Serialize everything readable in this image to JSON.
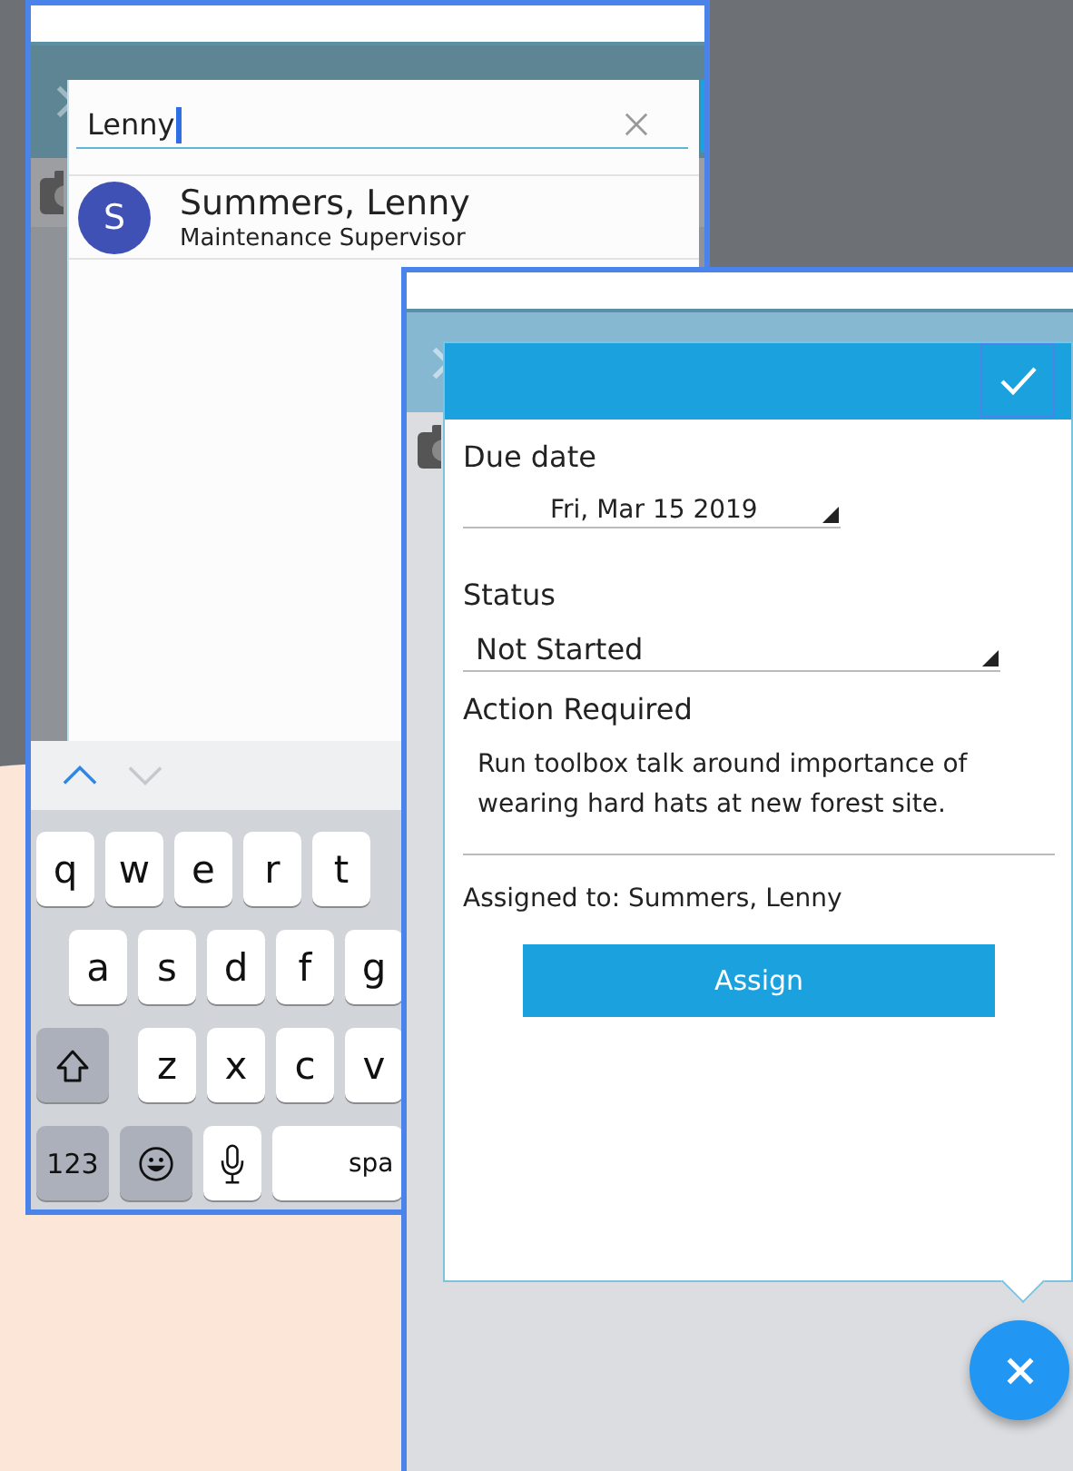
{
  "search_screen": {
    "search": {
      "value": "Lenny"
    },
    "results": [
      {
        "initial": "S",
        "name": "Summers, Lenny",
        "subtitle": "Maintenance Supervisor"
      }
    ],
    "keyboard": {
      "nav": [
        {
          "kind": "up",
          "disabled": false
        },
        {
          "kind": "down",
          "disabled": true
        }
      ],
      "rows": [
        {
          "keys": [
            {
              "kind": "letter",
              "label": "q"
            },
            {
              "kind": "letter",
              "label": "w"
            },
            {
              "kind": "letter",
              "label": "e"
            },
            {
              "kind": "letter",
              "label": "r"
            },
            {
              "kind": "letter",
              "label": "t"
            }
          ]
        },
        {
          "keys": [
            {
              "kind": "letter",
              "label": "a"
            },
            {
              "kind": "letter",
              "label": "s"
            },
            {
              "kind": "letter",
              "label": "d"
            },
            {
              "kind": "letter",
              "label": "f"
            },
            {
              "kind": "letter",
              "label": "g"
            }
          ]
        },
        {
          "keys": [
            {
              "kind": "shift"
            },
            {
              "kind": "letter",
              "label": "z"
            },
            {
              "kind": "letter",
              "label": "x"
            },
            {
              "kind": "letter",
              "label": "c"
            },
            {
              "kind": "letter",
              "label": "v"
            }
          ]
        },
        {
          "keys": [
            {
              "kind": "numbers",
              "label": "123"
            },
            {
              "kind": "emoji"
            },
            {
              "kind": "mic"
            },
            {
              "kind": "space",
              "label": "spa"
            }
          ]
        }
      ]
    }
  },
  "action_screen": {
    "fields": [
      {
        "kind": "date",
        "label": "Due date",
        "value": "Fri, Mar 15 2019"
      },
      {
        "kind": "select",
        "label": "Status",
        "value": "Not Started"
      },
      {
        "kind": "textarea",
        "label": "Action Required",
        "value": "Run toolbox talk around importance of wearing hard hats at new forest site."
      }
    ],
    "assigned": "Assigned to: Summers, Lenny",
    "assign_button": "Assign"
  }
}
